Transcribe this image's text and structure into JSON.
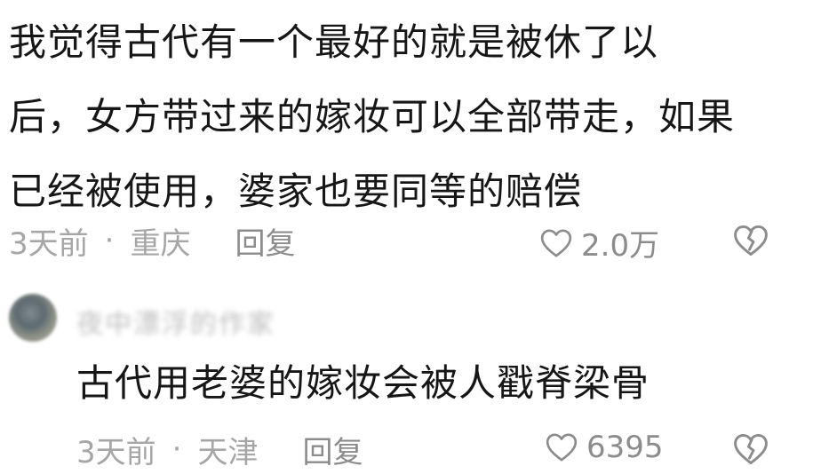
{
  "comment": {
    "lines": [
      "我觉得古代有一个最好的就是被休了以",
      "后，女方带过来的嫁妆可以全部带走，如果",
      "已经被使用，婆家也要同等的赔偿"
    ],
    "time": "3天前",
    "separator": "·",
    "location": "重庆",
    "reply_label": "回复",
    "like_count": "2.0万"
  },
  "reply": {
    "username": "夜中漂浮的作家",
    "text": "古代用老婆的嫁妆会被人戳脊梁骨",
    "time": "3天前",
    "separator": "·",
    "location": "天津",
    "reply_label": "回复",
    "like_count": "6395"
  }
}
